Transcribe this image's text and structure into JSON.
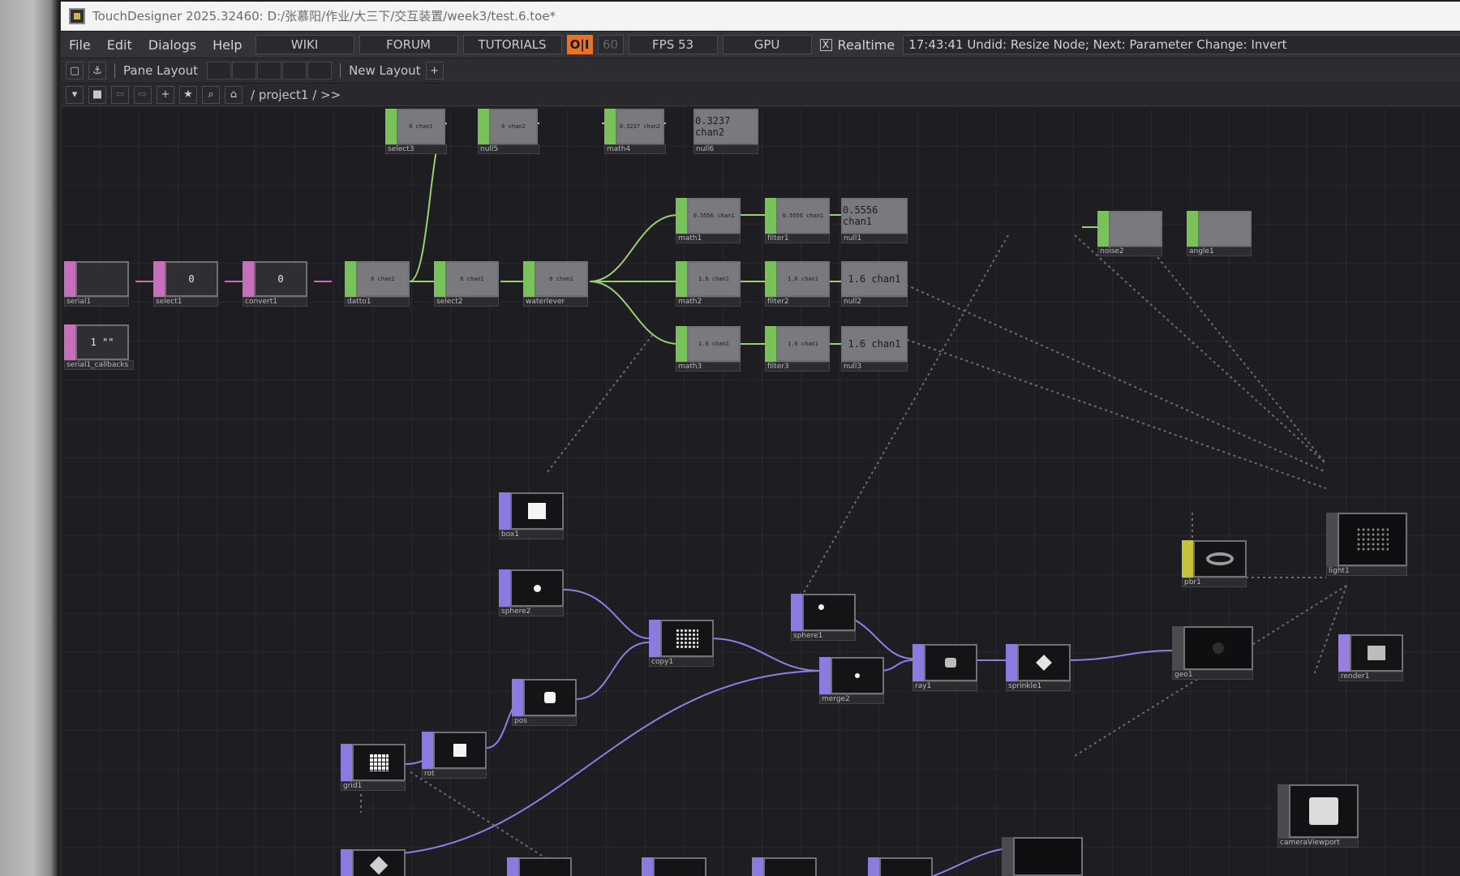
{
  "window": {
    "title": "TouchDesigner 2025.32460: D:/张慕阳/作业/大三下/交互装置/week3/test.6.toe*"
  },
  "menubar": {
    "menus": [
      "File",
      "Edit",
      "Dialogs",
      "Help"
    ],
    "wiki": "WIKI",
    "forum": "FORUM",
    "tutorials": "TUTORIALS",
    "perform": "O|I",
    "fps_cap": "60",
    "fps": "FPS  53",
    "gpu": "GPU",
    "realtime_check": "X",
    "realtime": "Realtime",
    "status": "17:43:41 Undid: Resize Node; Next: Parameter Change: Invert"
  },
  "layoutbar": {
    "pane_layout": "Pane Layout",
    "new_layout": "New Layout",
    "add": "+"
  },
  "pathbar": {
    "path": "/ project1 / >>"
  },
  "nodes": {
    "serial1": "serial1",
    "select1": "select1",
    "convert1": "convert1",
    "datto1": "datto1",
    "select3": "select3",
    "null5": "null5",
    "math4": "math4",
    "null6": "null6",
    "select2": "select2",
    "waterlever": "waterlever",
    "math1": "math1",
    "filter1": "filter1",
    "null1": "null1",
    "math2": "math2",
    "filter2": "filter2",
    "null2": "null2",
    "math3": "math3",
    "filter3": "filter3",
    "null3": "null3",
    "noise2": "noise2",
    "angle1": "angle1",
    "serial_callbacks": "serial1_callbacks",
    "box1": "box1",
    "sphere2": "sphere2",
    "copy1": "copy1",
    "sphere1": "sphere1",
    "merge2": "merge2",
    "ray1": "ray1",
    "sprinkle1": "sprinkle1",
    "geo1": "geo1",
    "pbr1": "pbr1",
    "light1": "light1",
    "render1": "render1",
    "cameraViewport": "cameraViewport",
    "pos": "pos",
    "grid1": "grid1",
    "rot": "rot"
  },
  "values": {
    "select1": "0",
    "convert1": "0",
    "serial_callbacks": "1 \"\"",
    "null6": "0.3237 chan2",
    "null1": "0.5556 chan1",
    "null2": "1.6 chan1",
    "null3": "1.6 chan1",
    "math4": "0.3237 chan2",
    "math1": "0.5556 chan1",
    "filter1": "0.5556 chan1",
    "math2": "1.6 chan1",
    "filter2": "1.6 chan1",
    "math3": "1.6 chan1",
    "filter3": "1.6 chan1",
    "select3": "0 chan1",
    "null5": "0 chan2",
    "datto1": "0 chan1",
    "select2": "0 chan1",
    "waterlever": "0 chan1"
  },
  "colors": {
    "chop": "#79c25b",
    "dat": "#c76fbd",
    "sop": "#8a7be0",
    "mat": "#c7c23c",
    "wire_chop": "#9ad06e",
    "wire_sop": "#8c7fe6",
    "accent": "#e8722a"
  }
}
